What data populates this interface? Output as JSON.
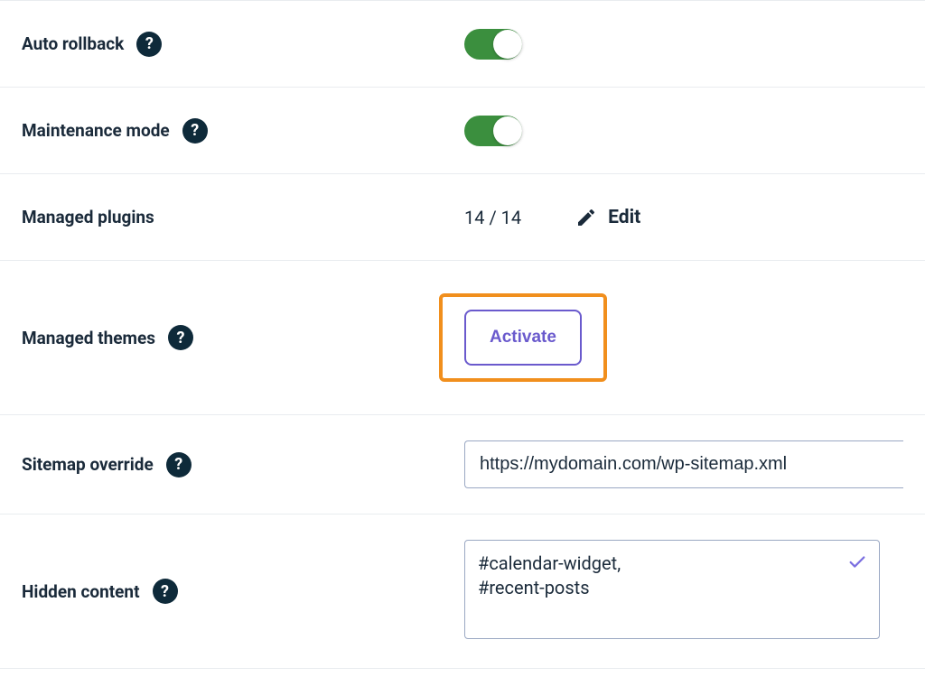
{
  "rows": {
    "auto_rollback": {
      "label": "Auto rollback",
      "toggle_on": true
    },
    "maintenance_mode": {
      "label": "Maintenance mode",
      "toggle_on": true
    },
    "managed_plugins": {
      "label": "Managed plugins",
      "value": "14 / 14",
      "edit": "Edit"
    },
    "managed_themes": {
      "label": "Managed themes",
      "activate": "Activate"
    },
    "sitemap_override": {
      "label": "Sitemap override",
      "value": "https://mydomain.com/wp-sitemap.xml"
    },
    "hidden_content": {
      "label": "Hidden content",
      "value": "#calendar-widget,\n#recent-posts"
    }
  },
  "help_glyph": "?",
  "colors": {
    "accent": "#6a5acd",
    "highlight": "#f18f1d",
    "toggle_on": "#3b8f3e",
    "help_bg": "#0e2a3a"
  }
}
